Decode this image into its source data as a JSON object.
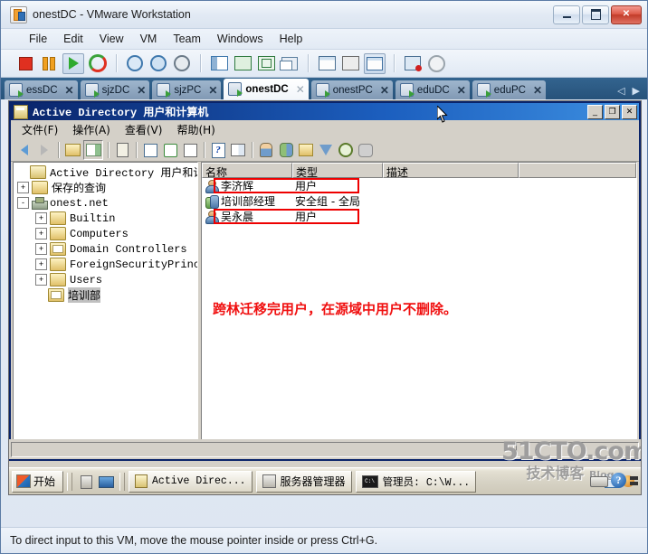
{
  "vmware": {
    "title": "onestDC - VMware Workstation",
    "app_icon": "vmware-icon",
    "window_buttons": {
      "minimize": "minimize-button",
      "maximize": "maximize-button",
      "close": "close-button"
    },
    "menu": [
      "File",
      "Edit",
      "View",
      "VM",
      "Team",
      "Windows",
      "Help"
    ],
    "toolbar_icons": [
      "power-off-icon",
      "suspend-icon",
      "power-on-icon",
      "reset-icon",
      "snapshot-take-icon",
      "snapshot-revert-icon",
      "snapshot-manager-icon",
      "show-sidebar-icon",
      "fullscreen-icon",
      "unity-icon",
      "multiple-windows-icon",
      "vm-settings-icon",
      "summary-view-icon",
      "console-view-icon",
      "clone-icon",
      "capture-icon"
    ],
    "tabs": [
      {
        "label": "essDC",
        "active": false
      },
      {
        "label": "sjzDC",
        "active": false
      },
      {
        "label": "sjzPC",
        "active": false
      },
      {
        "label": "onestDC",
        "active": true
      },
      {
        "label": "onestPC",
        "active": false
      },
      {
        "label": "eduDC",
        "active": false
      },
      {
        "label": "eduPC",
        "active": false
      }
    ],
    "tab_scroll_left": "◁",
    "tab_scroll_right": "▶",
    "hint": "To direct input to this VM, move the mouse pointer inside or press Ctrl+G."
  },
  "mmc": {
    "title_mono": "Active Directory ",
    "title_cn": "用户和计算机",
    "window_buttons": {
      "minimize": "_",
      "restore": "❐",
      "close": "✕"
    },
    "menu": [
      "文件(F)",
      "操作(A)",
      "查看(V)",
      "帮助(H)"
    ],
    "toolbar_icons": [
      "back-icon",
      "forward-icon",
      "up-one-level-icon",
      "show-hide-tree-icon",
      "properties-icon",
      "export-list-icon",
      "refresh-icon",
      "export-icon",
      "help-icon",
      "console-icon",
      "new-user-icon",
      "new-group-icon",
      "new-ou-icon",
      "filter-icon",
      "find-icon",
      "delegate-control-icon"
    ]
  },
  "tree": {
    "nodes": [
      {
        "label_mono": "Active Directory ",
        "label_cn": "用户和计算机",
        "indent": 0,
        "expander": "",
        "icon": "console-root-icon",
        "selected": false
      },
      {
        "label_mono": "",
        "label_cn": "保存的查询",
        "indent": 1,
        "expander": "+",
        "icon": "folder-icon",
        "selected": false
      },
      {
        "label_mono": "onest.net",
        "label_cn": "",
        "indent": 1,
        "expander": "-",
        "icon": "domain-icon",
        "selected": false
      },
      {
        "label_mono": "Builtin",
        "label_cn": "",
        "indent": 2,
        "expander": "+",
        "icon": "folder-icon",
        "selected": false
      },
      {
        "label_mono": "Computers",
        "label_cn": "",
        "indent": 2,
        "expander": "+",
        "icon": "folder-icon",
        "selected": false
      },
      {
        "label_mono": "Domain Controllers",
        "label_cn": "",
        "indent": 2,
        "expander": "+",
        "icon": "ou-folder-icon",
        "selected": false
      },
      {
        "label_mono": "ForeignSecurityPrincip",
        "label_cn": "",
        "indent": 2,
        "expander": "+",
        "icon": "folder-icon",
        "selected": false
      },
      {
        "label_mono": "Users",
        "label_cn": "",
        "indent": 2,
        "expander": "+",
        "icon": "folder-icon",
        "selected": false
      },
      {
        "label_mono": "",
        "label_cn": "培训部",
        "indent": 2,
        "expander": "",
        "icon": "ou-folder-icon",
        "selected": true
      }
    ]
  },
  "list": {
    "columns": [
      "名称",
      "类型",
      "描述",
      ""
    ],
    "rows": [
      {
        "icon": "user-icon",
        "name": "李济辉",
        "type": "用户",
        "description": "",
        "highlighted": true
      },
      {
        "icon": "group-icon",
        "name": "培训部经理",
        "type": "安全组 - 全局",
        "description": "",
        "highlighted": false
      },
      {
        "icon": "user-icon",
        "name": "吴永晨",
        "type": "用户",
        "description": "",
        "highlighted": true
      }
    ]
  },
  "annotation": {
    "text": "跨林迁移完用户，在源域中用户不删除。",
    "color": "#f01010"
  },
  "guest_taskbar": {
    "start_label": "开始",
    "quick_launch": [
      "server-manager-icon",
      "show-desktop-icon"
    ],
    "tasks": [
      {
        "icon": "mmc-icon",
        "label": "Active Direc...",
        "active": true
      },
      {
        "icon": "server-manager-icon",
        "label": "服务器管理器",
        "active": false
      },
      {
        "icon": "command-prompt-icon",
        "label": "管理员: C:\\W...",
        "active": false
      }
    ],
    "tray_icons": [
      "network-icon",
      "vmware-tools-icon"
    ]
  },
  "vm_status": {
    "keyboard_icon": "keyboard-icon",
    "help_icon": "help-icon",
    "help_glyph": "?",
    "spinner_icon": "spinner-icon"
  },
  "watermark": {
    "top": "51CTO.com",
    "bottom": "技术博客",
    "badge": "Blog"
  },
  "colors": {
    "accent": "#1c5fbf",
    "annotation_red": "#f01010",
    "tab_active_bg": "#ffffff",
    "mmc_chrome": "#d4d0c8"
  }
}
